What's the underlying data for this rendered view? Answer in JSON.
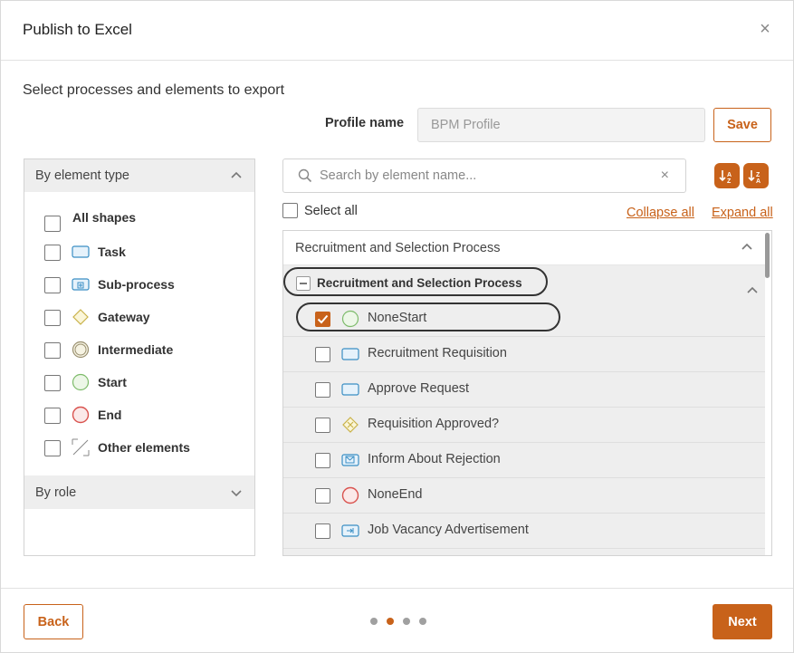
{
  "dialog": {
    "title": "Publish to Excel",
    "close_icon": "close-icon"
  },
  "subtitle": "Select processes and elements to export",
  "profile": {
    "label": "Profile name",
    "value": "",
    "placeholder": "BPM Profile",
    "save_label": "Save"
  },
  "left": {
    "by_element_type": "By element type",
    "types": [
      {
        "label": "All shapes",
        "icon": "none"
      },
      {
        "label": "Task",
        "icon": "task-icon"
      },
      {
        "label": "Sub-process",
        "icon": "sub-process-icon"
      },
      {
        "label": "Gateway",
        "icon": "gateway-icon"
      },
      {
        "label": "Intermediate",
        "icon": "intermediate-event-icon"
      },
      {
        "label": "Start",
        "icon": "start-event-icon"
      },
      {
        "label": "End",
        "icon": "end-event-icon"
      },
      {
        "label": "Other elements",
        "icon": "other-elements-icon"
      }
    ],
    "by_role": "By role"
  },
  "search": {
    "placeholder": "Search by element name..."
  },
  "select_all": "Select all",
  "collapse_all": "Collapse all",
  "expand_all": "Expand all",
  "tree": {
    "root_label": "Recruitment and Selection Process",
    "group_label": "Recruitment and Selection Process",
    "items": [
      {
        "label": "NoneStart",
        "icon": "start-event-icon",
        "checked": true
      },
      {
        "label": "Recruitment Requisition",
        "icon": "task-icon",
        "checked": false
      },
      {
        "label": "Approve Request",
        "icon": "task-icon",
        "checked": false
      },
      {
        "label": "Requisition Approved?",
        "icon": "gateway-icon",
        "checked": false
      },
      {
        "label": "Inform About Rejection",
        "icon": "send-task-icon",
        "checked": false
      },
      {
        "label": "NoneEnd",
        "icon": "end-event-icon",
        "checked": false
      },
      {
        "label": "Job Vacancy Advertisement",
        "icon": "call-activity-icon",
        "checked": false
      }
    ]
  },
  "footer": {
    "back_label": "Back",
    "next_label": "Next",
    "steps": 4,
    "current_step": 2
  },
  "colors": {
    "accent": "#c8621a",
    "panel_bg": "#eeeeee",
    "start": "#5aa95a",
    "end": "#d9534f",
    "task": "#3a8ec4"
  }
}
